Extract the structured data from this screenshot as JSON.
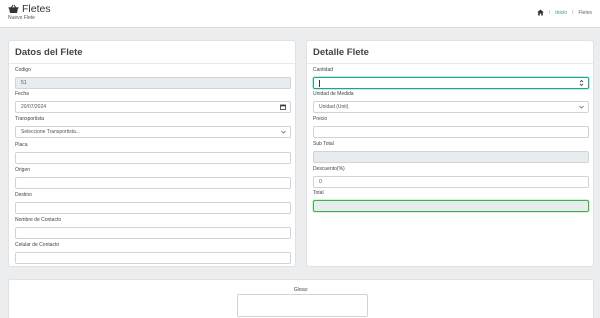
{
  "header": {
    "title": "Fletes",
    "subtitle": "Nuevo Flete",
    "icon": "basket-icon"
  },
  "breadcrumb": {
    "home_icon": "home-icon",
    "separator": "/",
    "link": "Inicio",
    "current": "Fletes"
  },
  "datos_flete": {
    "title": "Datos del Flete",
    "codigo": {
      "label": "Codigo",
      "value": "51"
    },
    "fecha": {
      "label": "Fecha",
      "value": "20/07/2024"
    },
    "transportista": {
      "label": "Transportista",
      "value": "Seleccione Transportista..."
    },
    "placa": {
      "label": "Placa",
      "value": ""
    },
    "origen": {
      "label": "Origen",
      "value": ""
    },
    "destino": {
      "label": "Destino",
      "value": ""
    },
    "nombre_contacto": {
      "label": "Nombre de Contacto",
      "value": ""
    },
    "celular_contacto": {
      "label": "Celular de Contacto",
      "value": ""
    }
  },
  "detalle_flete": {
    "title": "Detalle Flete",
    "cantidad": {
      "label": "Cantidad",
      "value": ""
    },
    "unidad_medida": {
      "label": "Unidad de Medida",
      "value": "Unidad (Unit)"
    },
    "precio": {
      "label": "Precio",
      "value": ""
    },
    "sub_total": {
      "label": "Sub Total",
      "value": ""
    },
    "descuento": {
      "label": "Descuento(%)",
      "value": "0"
    },
    "total": {
      "label": "Total",
      "value": ""
    }
  },
  "glosa": {
    "label": "Glosa:",
    "value": ""
  },
  "colors": {
    "accent": "#1aa68f",
    "success_border": "#39b54a",
    "readonly_bg": "#e9ecef",
    "page_bg": "#ecedee"
  }
}
